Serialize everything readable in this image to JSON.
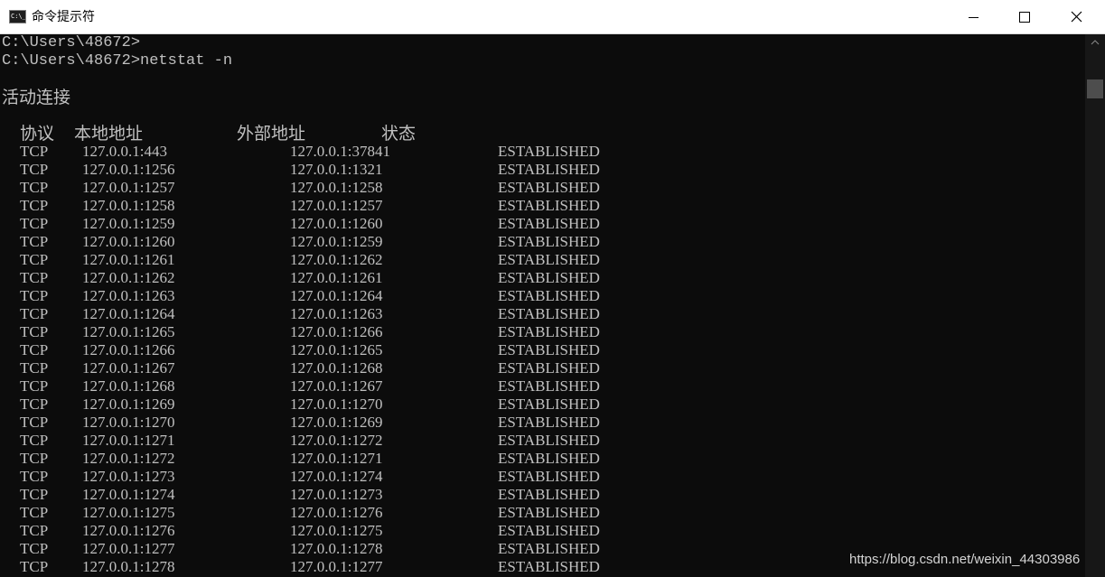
{
  "window": {
    "title": "命令提示符",
    "icon_text": "C:\\_"
  },
  "console": {
    "prompt_lines": [
      "C:\\Users\\48672>",
      "C:\\Users\\48672>netstat -n"
    ],
    "section_title": "活动连接",
    "headers": {
      "proto": "协议",
      "local": "本地地址",
      "foreign": "外部地址",
      "state": "状态"
    },
    "rows": [
      {
        "proto": "TCP",
        "local": "127.0.0.1:443",
        "foreign": "127.0.0.1:37841",
        "state": "ESTABLISHED"
      },
      {
        "proto": "TCP",
        "local": "127.0.0.1:1256",
        "foreign": "127.0.0.1:1321",
        "state": "ESTABLISHED"
      },
      {
        "proto": "TCP",
        "local": "127.0.0.1:1257",
        "foreign": "127.0.0.1:1258",
        "state": "ESTABLISHED"
      },
      {
        "proto": "TCP",
        "local": "127.0.0.1:1258",
        "foreign": "127.0.0.1:1257",
        "state": "ESTABLISHED"
      },
      {
        "proto": "TCP",
        "local": "127.0.0.1:1259",
        "foreign": "127.0.0.1:1260",
        "state": "ESTABLISHED"
      },
      {
        "proto": "TCP",
        "local": "127.0.0.1:1260",
        "foreign": "127.0.0.1:1259",
        "state": "ESTABLISHED"
      },
      {
        "proto": "TCP",
        "local": "127.0.0.1:1261",
        "foreign": "127.0.0.1:1262",
        "state": "ESTABLISHED"
      },
      {
        "proto": "TCP",
        "local": "127.0.0.1:1262",
        "foreign": "127.0.0.1:1261",
        "state": "ESTABLISHED"
      },
      {
        "proto": "TCP",
        "local": "127.0.0.1:1263",
        "foreign": "127.0.0.1:1264",
        "state": "ESTABLISHED"
      },
      {
        "proto": "TCP",
        "local": "127.0.0.1:1264",
        "foreign": "127.0.0.1:1263",
        "state": "ESTABLISHED"
      },
      {
        "proto": "TCP",
        "local": "127.0.0.1:1265",
        "foreign": "127.0.0.1:1266",
        "state": "ESTABLISHED"
      },
      {
        "proto": "TCP",
        "local": "127.0.0.1:1266",
        "foreign": "127.0.0.1:1265",
        "state": "ESTABLISHED"
      },
      {
        "proto": "TCP",
        "local": "127.0.0.1:1267",
        "foreign": "127.0.0.1:1268",
        "state": "ESTABLISHED"
      },
      {
        "proto": "TCP",
        "local": "127.0.0.1:1268",
        "foreign": "127.0.0.1:1267",
        "state": "ESTABLISHED"
      },
      {
        "proto": "TCP",
        "local": "127.0.0.1:1269",
        "foreign": "127.0.0.1:1270",
        "state": "ESTABLISHED"
      },
      {
        "proto": "TCP",
        "local": "127.0.0.1:1270",
        "foreign": "127.0.0.1:1269",
        "state": "ESTABLISHED"
      },
      {
        "proto": "TCP",
        "local": "127.0.0.1:1271",
        "foreign": "127.0.0.1:1272",
        "state": "ESTABLISHED"
      },
      {
        "proto": "TCP",
        "local": "127.0.0.1:1272",
        "foreign": "127.0.0.1:1271",
        "state": "ESTABLISHED"
      },
      {
        "proto": "TCP",
        "local": "127.0.0.1:1273",
        "foreign": "127.0.0.1:1274",
        "state": "ESTABLISHED"
      },
      {
        "proto": "TCP",
        "local": "127.0.0.1:1274",
        "foreign": "127.0.0.1:1273",
        "state": "ESTABLISHED"
      },
      {
        "proto": "TCP",
        "local": "127.0.0.1:1275",
        "foreign": "127.0.0.1:1276",
        "state": "ESTABLISHED"
      },
      {
        "proto": "TCP",
        "local": "127.0.0.1:1276",
        "foreign": "127.0.0.1:1275",
        "state": "ESTABLISHED"
      },
      {
        "proto": "TCP",
        "local": "127.0.0.1:1277",
        "foreign": "127.0.0.1:1278",
        "state": "ESTABLISHED"
      },
      {
        "proto": "TCP",
        "local": "127.0.0.1:1278",
        "foreign": "127.0.0.1:1277",
        "state": "ESTABLISHED"
      }
    ]
  },
  "watermark": "https://blog.csdn.net/weixin_44303986",
  "colors": {
    "console_bg": "#0c0c0c",
    "console_text": "#c0c0c0",
    "titlebar_bg": "#ffffff"
  }
}
